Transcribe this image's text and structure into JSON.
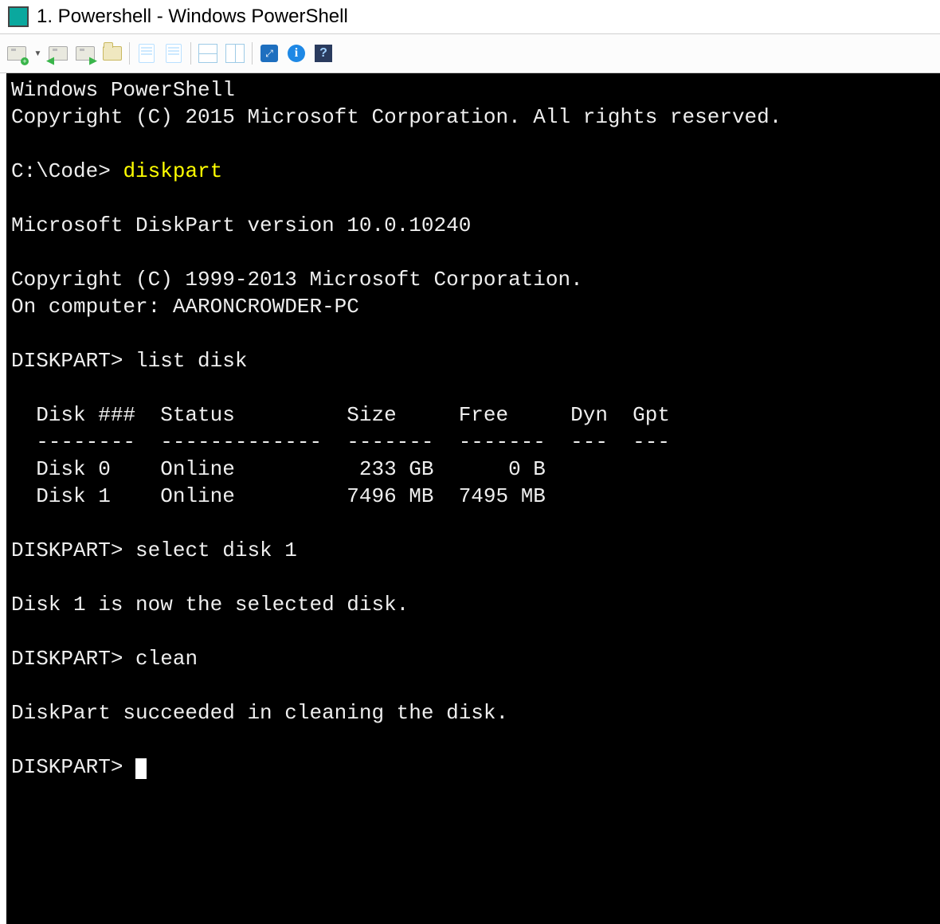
{
  "titlebar": {
    "title": "1. Powershell - Windows PowerShell"
  },
  "toolbar": {
    "buttons": [
      {
        "name": "new-tab-button",
        "icon": "tab-plus"
      },
      {
        "name": "dropdown-button",
        "icon": "chev"
      },
      {
        "name": "tab-back-button",
        "icon": "tab-left"
      },
      {
        "name": "tab-forward-button",
        "icon": "tab-right"
      },
      {
        "name": "folder-button",
        "icon": "folder"
      },
      {
        "name": "doc1-button",
        "icon": "doc"
      },
      {
        "name": "doc2-button",
        "icon": "doc"
      },
      {
        "name": "split-h-button",
        "icon": "split-h"
      },
      {
        "name": "split-v-button",
        "icon": "split-v"
      },
      {
        "name": "fullscreen-button",
        "icon": "full"
      },
      {
        "name": "info-button",
        "icon": "info"
      },
      {
        "name": "help-button",
        "icon": "help"
      }
    ]
  },
  "terminal": {
    "banner1": "Windows PowerShell",
    "banner2": "Copyright (C) 2015 Microsoft Corporation. All rights reserved.",
    "prompt1_prefix": "C:\\Code> ",
    "prompt1_cmd": "diskpart",
    "dp_version": "Microsoft DiskPart version 10.0.10240",
    "dp_copyright": "Copyright (C) 1999-2013 Microsoft Corporation.",
    "dp_computer": "On computer: AARONCROWDER-PC",
    "dp_prompt": "DISKPART> ",
    "cmd_list": "list disk",
    "tbl_header": "  Disk ###  Status         Size     Free     Dyn  Gpt",
    "tbl_divider": "  --------  -------------  -------  -------  ---  ---",
    "tbl_row0": "  Disk 0    Online          233 GB      0 B",
    "tbl_row1": "  Disk 1    Online         7496 MB  7495 MB",
    "cmd_select": "select disk 1",
    "msg_selected": "Disk 1 is now the selected disk.",
    "cmd_clean": "clean",
    "msg_clean": "DiskPart succeeded in cleaning the disk."
  }
}
